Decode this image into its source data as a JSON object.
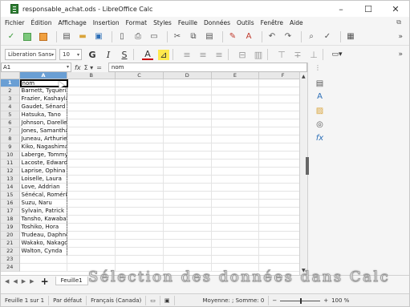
{
  "window": {
    "title": "responsable_achat.ods - LibreOffice Calc",
    "controls": [
      "–",
      "☐",
      "✕"
    ]
  },
  "menu": {
    "items": [
      "Fichier",
      "Édition",
      "Affichage",
      "Insertion",
      "Format",
      "Styles",
      "Feuille",
      "Données",
      "Outils",
      "Fenêtre",
      "Aide"
    ]
  },
  "format_bar": {
    "font_name": "Liberation Sans",
    "font_size": "10"
  },
  "formula_bar": {
    "cell_ref": "A1",
    "content": "nom"
  },
  "columns": [
    "A",
    "B",
    "C",
    "D",
    "E",
    "F"
  ],
  "rows": [
    {
      "n": "1",
      "a": "nom"
    },
    {
      "n": "2",
      "a": "Barnett, Tyqueria"
    },
    {
      "n": "3",
      "a": "Frazier, Kashayla"
    },
    {
      "n": "4",
      "a": "Gaudet, Sénard"
    },
    {
      "n": "5",
      "a": "Hatsuka, Tano"
    },
    {
      "n": "6",
      "a": "Johnson, Darelle"
    },
    {
      "n": "7",
      "a": "Jones, Samantha"
    },
    {
      "n": "8",
      "a": "Juneau, Arthurien"
    },
    {
      "n": "9",
      "a": "Kiko, Nagashima"
    },
    {
      "n": "10",
      "a": "Laberge, Tommy"
    },
    {
      "n": "11",
      "a": "Lacoste, Edward"
    },
    {
      "n": "12",
      "a": "Laprise, Ophina"
    },
    {
      "n": "13",
      "a": "Loiselle, Laura"
    },
    {
      "n": "14",
      "a": "Love, Addrian"
    },
    {
      "n": "15",
      "a": "Sénécal, Roméric"
    },
    {
      "n": "16",
      "a": "Suzu, Naru"
    },
    {
      "n": "17",
      "a": "Sylvain, Patrick"
    },
    {
      "n": "18",
      "a": "Tansho, Kawabata"
    },
    {
      "n": "19",
      "a": "Toshiko, Hora"
    },
    {
      "n": "20",
      "a": "Trudeau, Daphnee"
    },
    {
      "n": "21",
      "a": "Wakako, Nakagome"
    },
    {
      "n": "22",
      "a": "Walton, Cynda"
    },
    {
      "n": "23",
      "a": ""
    },
    {
      "n": "24",
      "a": ""
    }
  ],
  "sheet_tabs": {
    "active": "Feuille1"
  },
  "status": {
    "sheet": "Feuille 1 sur 1",
    "style": "Par défaut",
    "language": "Français (Canada)",
    "summary": "Moyenne: ; Somme: 0",
    "zoom": "100 %"
  },
  "caption": "Sélection des données dans Calc"
}
